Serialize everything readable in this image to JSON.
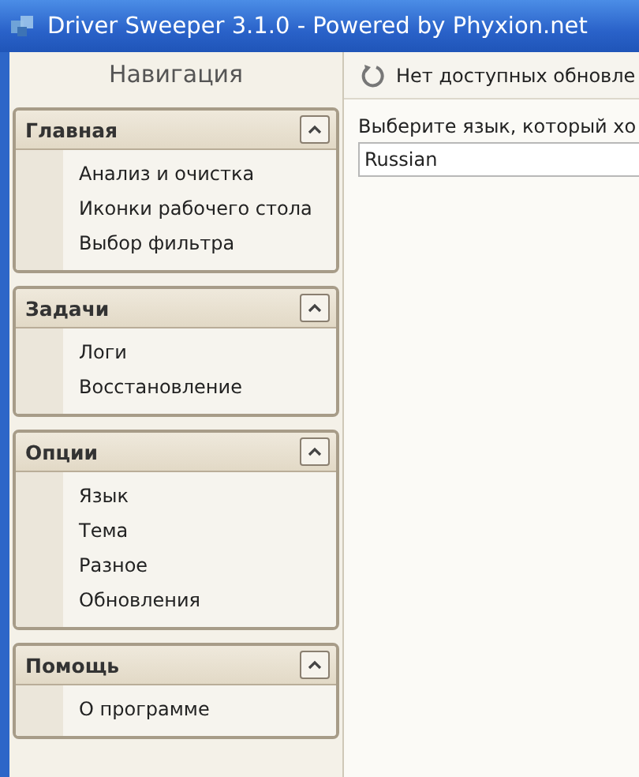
{
  "window": {
    "title": "Driver Sweeper 3.1.0 - Powered by Phyxion.net"
  },
  "navigation": {
    "title": "Навигация",
    "groups": [
      {
        "title": "Главная",
        "expanded": true,
        "items": [
          "Анализ и очистка",
          "Иконки рабочего стола",
          "Выбор фильтра"
        ]
      },
      {
        "title": "Задачи",
        "expanded": true,
        "items": [
          "Логи",
          "Восстановление"
        ]
      },
      {
        "title": "Опции",
        "expanded": true,
        "items": [
          "Язык",
          "Тема",
          "Разное",
          "Обновления"
        ]
      },
      {
        "title": "Помощь",
        "expanded": true,
        "items": [
          "О программе"
        ]
      }
    ]
  },
  "status": {
    "text": "Нет доступных обновле"
  },
  "language": {
    "label": "Выберите язык, который хо",
    "value": "Russian"
  }
}
